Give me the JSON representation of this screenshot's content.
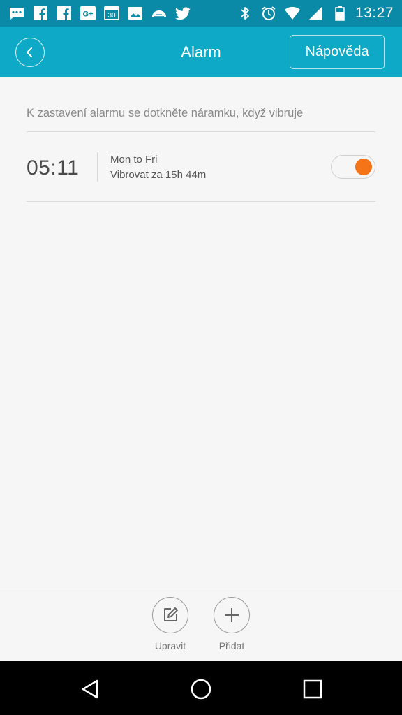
{
  "status_bar": {
    "left_icons": [
      "chat-icon",
      "facebook-icon",
      "facebook-icon",
      "google-plus-icon",
      "calendar-icon",
      "image-icon",
      "cloud-icon",
      "twitter-icon"
    ],
    "calendar_day": "30",
    "google_plus_text": "G+",
    "right_icons": [
      "bluetooth-icon",
      "alarm-clock-icon",
      "wifi-icon",
      "signal-icon",
      "battery-icon"
    ],
    "time": "13:27"
  },
  "header": {
    "title": "Alarm",
    "help_label": "Nápověda",
    "background": "#0ea9c6"
  },
  "hint": "K zastavení alarmu se dotkněte náramku, když vibruje",
  "alarm": {
    "time": "05:11",
    "days": "Mon to Fri",
    "note": "Vibrovat za 15h 44m",
    "enabled": true,
    "toggle_color": "#f57417"
  },
  "toolbar": {
    "edit_label": "Upravit",
    "add_label": "Přidat"
  },
  "nav": {
    "icons": [
      "back-triangle-icon",
      "home-circle-icon",
      "recents-square-icon"
    ]
  }
}
